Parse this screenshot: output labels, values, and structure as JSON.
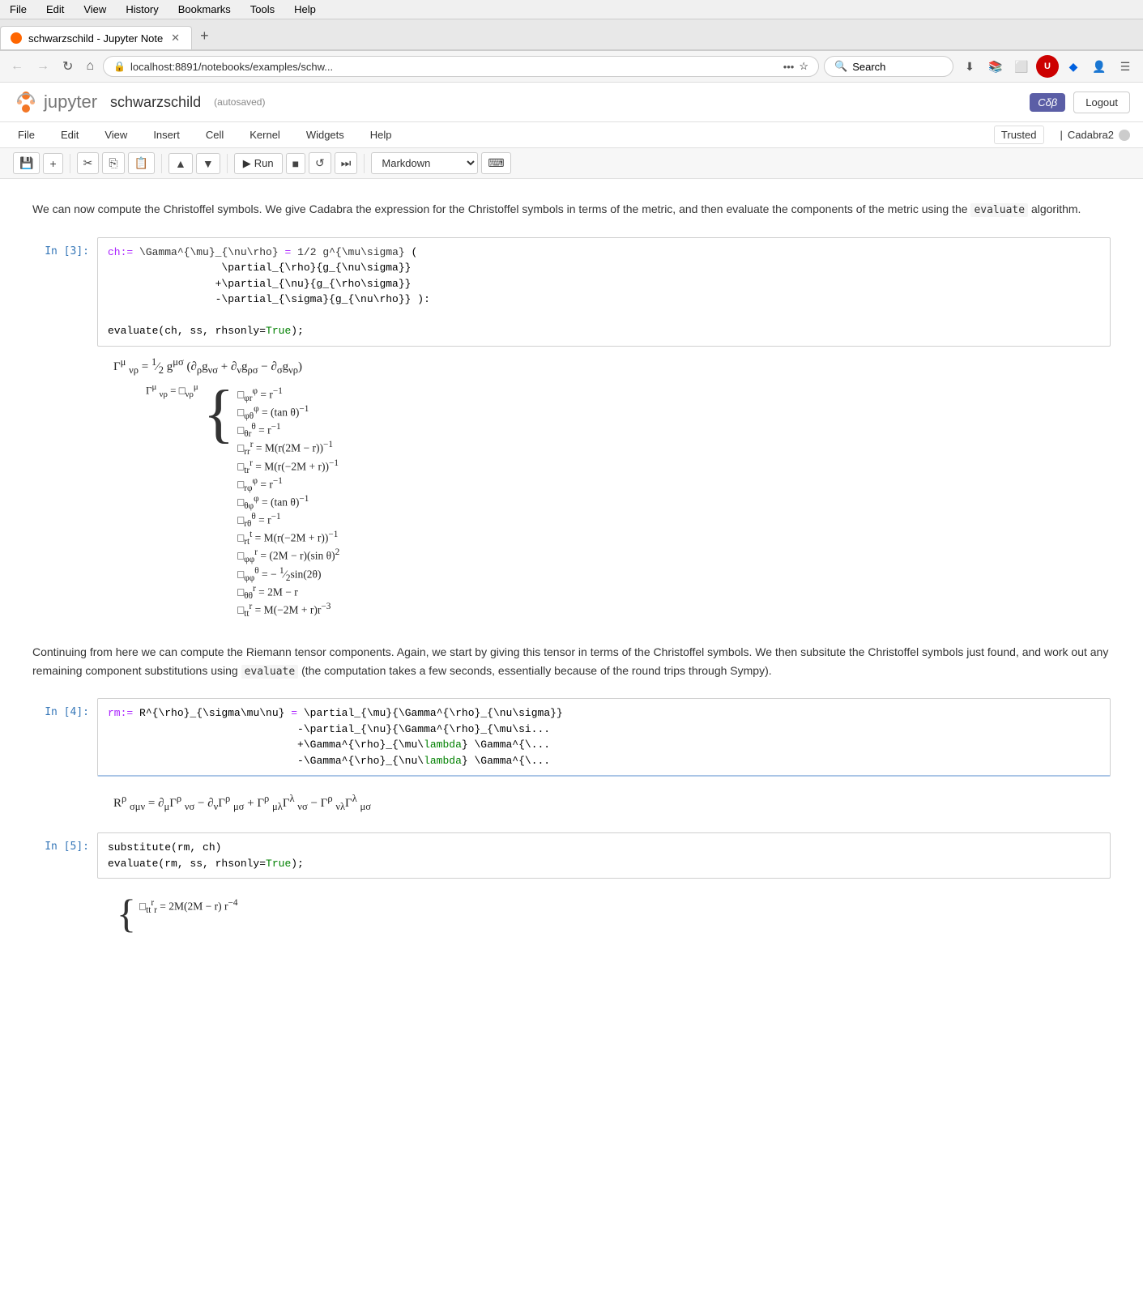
{
  "browser": {
    "menu": [
      "File",
      "Edit",
      "View",
      "History",
      "Bookmarks",
      "Tools",
      "Help"
    ],
    "tab_title": "schwarzschild - Jupyter Note",
    "address": "localhost:8891/notebooks/examples/schw...",
    "search_placeholder": "Search",
    "new_tab": "+"
  },
  "jupyter": {
    "logo_text": "jupyter",
    "notebook_title": "schwarzschild",
    "autosaved": "(autosaved)",
    "kernel_badge": "Cδβ",
    "logout_btn": "Logout",
    "menu": [
      "File",
      "Edit",
      "View",
      "Insert",
      "Cell",
      "Kernel",
      "Widgets",
      "Help"
    ],
    "trusted": "Trusted",
    "cadabra": "Cadabra2",
    "toolbar": {
      "cell_type": "Markdown"
    }
  },
  "cells": {
    "markdown1": {
      "text": "We can now compute the Christoffel symbols. We give Cadabra the expression for the Christoffel symbols in terms of the metric, and then evaluate the components of the metric using the ",
      "code_span": "evaluate",
      "text2": " algorithm."
    },
    "in3": {
      "prompt": "In [3]:",
      "code": "ch:= \\Gamma^{\\mu}_{\\nu\\rho} = 1/2 g^{\\mu\\sigma} (\n                  \\partial_{\\rho}{g_{\\nu\\sigma}}\n                 +\\partial_{\\nu}{g_{\\rho\\sigma}}\n                 -\\partial_{\\sigma}{g_{\\nu\\rho}} ):\n\nevaluate(ch, ss, rhsonly=True);"
    },
    "out3_formula": "Γμ νρ = ½ gμσ (∂ρgνσ + ∂νgρσ − ∂σgνρ)",
    "in4": {
      "prompt": "In [4]:",
      "code": "rm:= R^{\\rho}_{\\sigma\\mu\\nu} = \\partial_{\\mu}{\\Gamma^{\\rho}_{\\nu\\sigma}}\n                              -\\partial_{\\nu}{\\Gamma^{\\rho}_{\\mu\\sigma}}\n                              +\\Gamma^{\\rho}_{\\mu\\lambda} \\Gamma^{\\lambda}\n                              -\\Gamma^{\\rho}_{\\nu\\lambda} \\Gamma^{\\lambda}"
    },
    "out4_formula": "Rρ σμν = ∂μΓρ νσ − ∂νΓρ μσ + Γρ μλΓλ νσ − Γρ νλΓλ μσ",
    "in5": {
      "prompt": "In [5]:",
      "code": "substitute(rm, ch)\nevaluate(rm, ss, rhsonly=True);"
    },
    "markdown2": {
      "text1": "Continuing from here we can compute the Riemann tensor components. Again, we start by giving this tensor in terms of the Christoffel symbols. We then subsitute the Christoffel symbols just found, and work out any remaining component substitutions using ",
      "code_span": "evaluate",
      "text2": " (the computation takes a few seconds, essentially because of the round trips through Sympy)."
    }
  }
}
